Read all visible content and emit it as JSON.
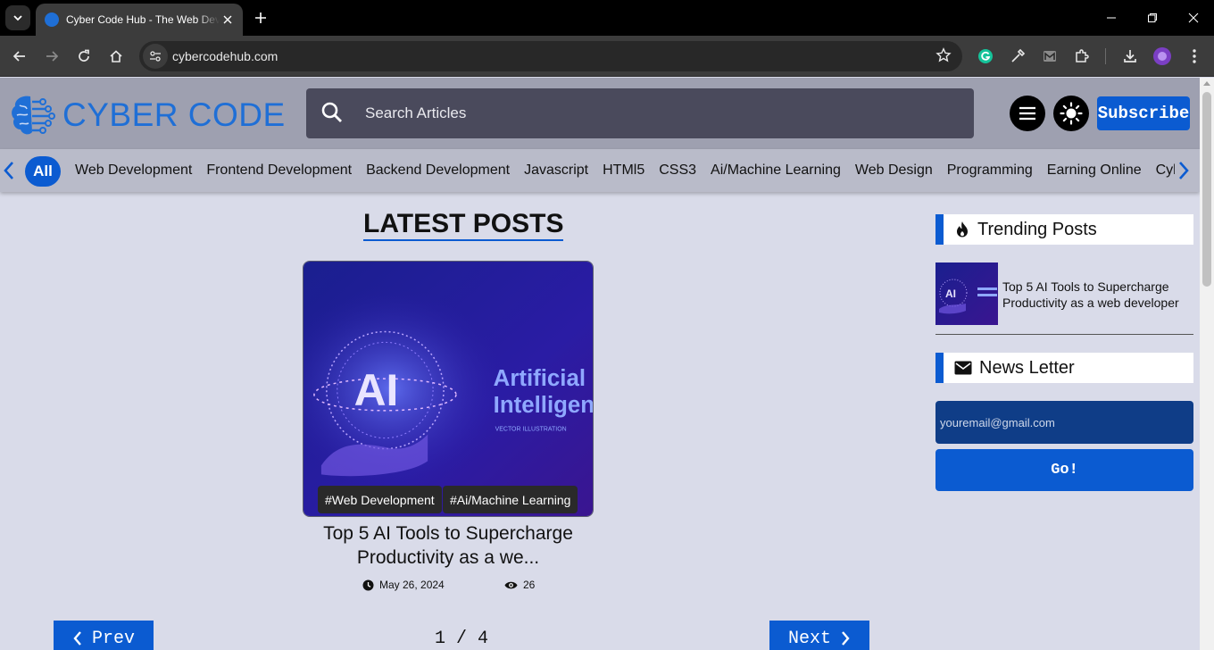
{
  "browser": {
    "tab_title": "Cyber Code Hub - The Web Developer Hub",
    "url": "cybercodehub.com"
  },
  "header": {
    "logo_text": "CYBER CODE",
    "search_placeholder": "Search Articles",
    "subscribe_label": "Subscribe"
  },
  "categories": {
    "all_label": "All",
    "items": [
      "Web Development",
      "Frontend Development",
      "Backend Development",
      "Javascript",
      "HTMl5",
      "CSS3",
      "Ai/Machine Learning",
      "Web Design",
      "Programming",
      "Earning Online",
      "Cyber Security"
    ]
  },
  "main": {
    "section_title": "LATEST POSTS",
    "post": {
      "image_text_ai": "AI",
      "image_text_line1": "Artificial",
      "image_text_line2": "Intelligence",
      "image_text_sub": "VECTOR ILLUSTRATION",
      "tags": [
        "#Web Development",
        "#Ai/Machine Learning"
      ],
      "title": "Top 5 AI Tools to Supercharge Productivity as a we...",
      "date": "May 26, 2024",
      "views": "26"
    },
    "pagination": {
      "prev_label": "Prev",
      "next_label": "Next",
      "page_indicator": "1 / 4"
    }
  },
  "sidebar": {
    "trending_heading": "Trending Posts",
    "trending": [
      {
        "title": "Top 5 AI Tools to Supercharge Productivity as a web developer"
      }
    ],
    "newsletter_heading": "News Letter",
    "email_placeholder": "youremail@gmail.com",
    "go_label": "Go!"
  },
  "colors": {
    "accent": "#0b5bd1",
    "header_bg": "#9ea0b0",
    "page_bg": "#d9dbe9"
  }
}
